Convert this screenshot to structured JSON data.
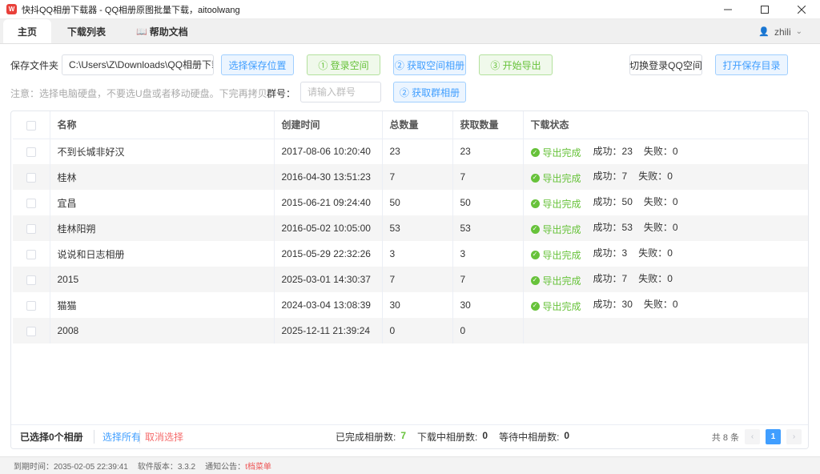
{
  "window": {
    "title": "快抖QQ相册下载器 - QQ相册原图批量下载，aitoolwang",
    "icon_label": "W"
  },
  "tabs": [
    {
      "label": "主页"
    },
    {
      "label": "下载列表"
    },
    {
      "label": "帮助文档"
    }
  ],
  "user": {
    "name": "zhili"
  },
  "toolbar": {
    "folder_label": "保存文件夹",
    "folder_value": "C:\\Users\\Z\\Downloads\\QQ相册下载",
    "choose_folder": "选择保存位置",
    "login_space": "① 登录空间",
    "get_space_albums": "② 获取空间相册",
    "start_export": "③ 开始导出",
    "switch_account": "切换登录QQ空间",
    "open_folder": "打开保存目录"
  },
  "notice": "注意：选择电脑硬盘，不要选U盘或者移动硬盘。下完再拷贝",
  "group": {
    "label": "群号：",
    "placeholder": "请输入群号",
    "get_group_albums": "② 获取群相册"
  },
  "table": {
    "headers": [
      "名称",
      "创建时间",
      "总数量",
      "获取数量",
      "下载状态"
    ],
    "rows": [
      {
        "name": "不到长城非好汉",
        "created": "2017-08-06 10:20:40",
        "total": "23",
        "fetched": "23",
        "status": "导出完成",
        "success": "成功：23",
        "fail": "失败：0"
      },
      {
        "name": "桂林",
        "created": "2016-04-30 13:51:23",
        "total": "7",
        "fetched": "7",
        "status": "导出完成",
        "success": "成功：7",
        "fail": "失败：0"
      },
      {
        "name": "宜昌",
        "created": "2015-06-21 09:24:40",
        "total": "50",
        "fetched": "50",
        "status": "导出完成",
        "success": "成功：50",
        "fail": "失败：0"
      },
      {
        "name": "桂林阳朔",
        "created": "2016-05-02 10:05:00",
        "total": "53",
        "fetched": "53",
        "status": "导出完成",
        "success": "成功：53",
        "fail": "失败：0"
      },
      {
        "name": "说说和日志相册",
        "created": "2015-05-29 22:32:26",
        "total": "3",
        "fetched": "3",
        "status": "导出完成",
        "success": "成功：3",
        "fail": "失败：0"
      },
      {
        "name": "2015",
        "created": "2025-03-01 14:30:37",
        "total": "7",
        "fetched": "7",
        "status": "导出完成",
        "success": "成功：7",
        "fail": "失败：0"
      },
      {
        "name": "猫猫",
        "created": "2024-03-04 13:08:39",
        "total": "30",
        "fetched": "30",
        "status": "导出完成",
        "success": "成功：30",
        "fail": "失败：0"
      },
      {
        "name": "2008",
        "created": "2025-12-11 21:39:24",
        "total": "0",
        "fetched": "0",
        "status": "",
        "success": "",
        "fail": ""
      }
    ]
  },
  "footer": {
    "selected": "已选择0个相册",
    "select_all": "选择所有",
    "cancel_select": "取消选择",
    "done_label": "已完成相册数:",
    "done_count": "7",
    "downloading_label": "下载中相册数:",
    "downloading_count": "0",
    "waiting_label": "等待中相册数:",
    "waiting_count": "0",
    "total": "共 8 条",
    "page": "1",
    "prev": "‹",
    "next": "›"
  },
  "statusbar": {
    "expire": "到期时间：2035-02-05 22:39:41",
    "version": "软件版本：3.3.2",
    "notice_label": "通知公告：",
    "notice_link": "t档菜单"
  },
  "colors": {
    "accent": "#409eff",
    "success": "#67c23a",
    "danger": "#f56c6c"
  },
  "icons": {
    "app": "app-logo-icon",
    "minimize": "minimize-icon",
    "maximize": "maximize-icon",
    "close": "close-icon",
    "user": "user-icon",
    "book": "book-icon",
    "status": "check-circle-icon"
  }
}
